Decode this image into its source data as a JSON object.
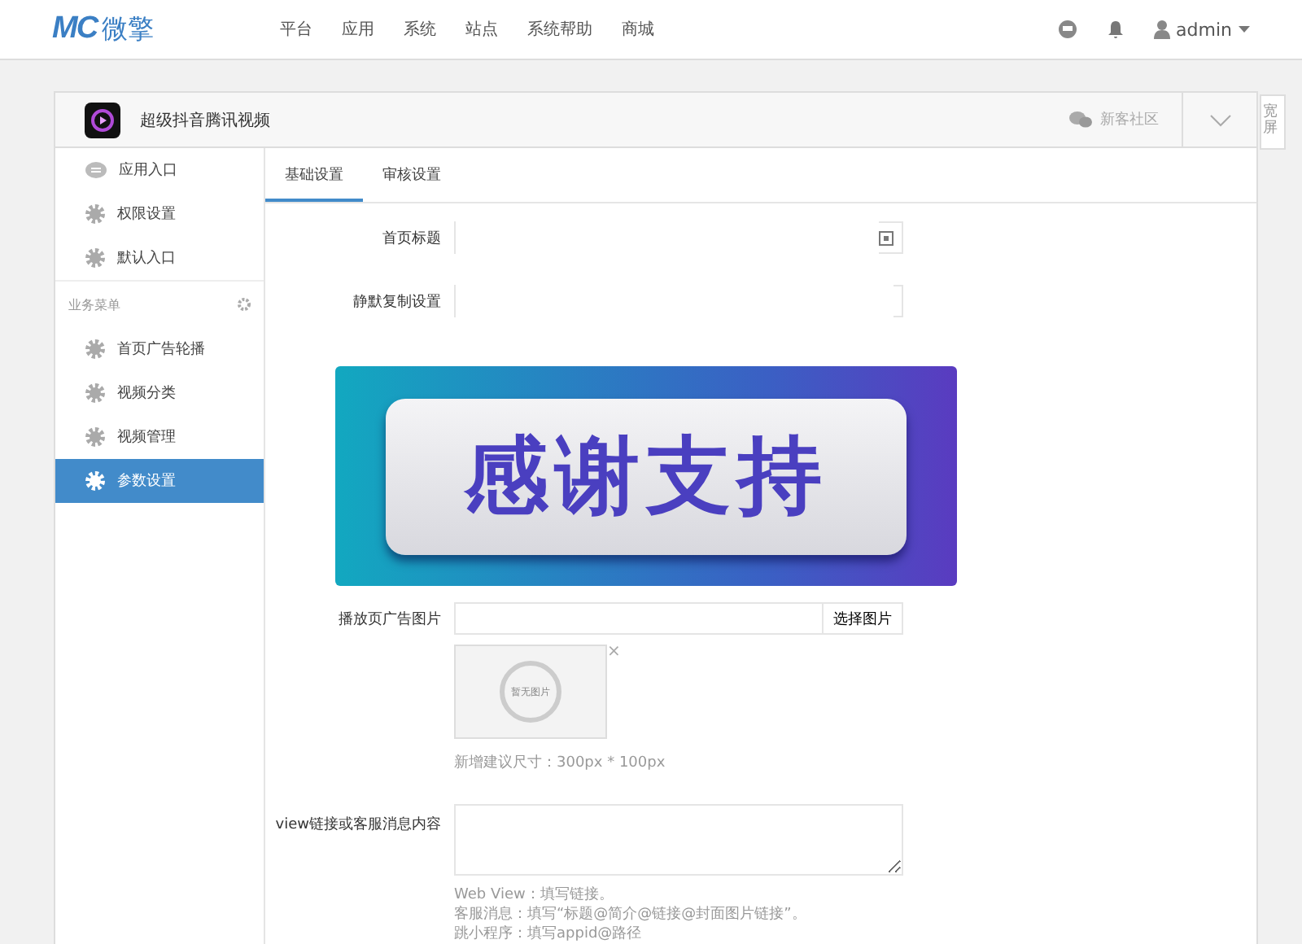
{
  "topbar": {
    "logo_mark": "MC",
    "logo_text": "微擎",
    "nav": [
      "平台",
      "应用",
      "系统",
      "站点",
      "系统帮助",
      "商城"
    ],
    "user": "admin"
  },
  "app": {
    "title": "超级抖音腾讯视频",
    "community": "新客社区"
  },
  "widescreen": "宽屏",
  "sidebar": {
    "items": [
      {
        "label": "应用入口",
        "kind": "chat",
        "selected": false
      },
      {
        "label": "权限设置",
        "kind": "gear",
        "selected": false
      },
      {
        "label": "默认入口",
        "kind": "gear",
        "selected": false
      }
    ],
    "section": "业务菜单",
    "section_items": [
      {
        "label": "首页广告轮播",
        "kind": "gear",
        "selected": false
      },
      {
        "label": "视频分类",
        "kind": "gear",
        "selected": false
      },
      {
        "label": "视频管理",
        "kind": "gear",
        "selected": false
      },
      {
        "label": "参数设置",
        "kind": "gear",
        "selected": true
      }
    ]
  },
  "tabs": [
    {
      "label": "基础设置",
      "selected": true
    },
    {
      "label": "审核设置",
      "selected": false
    }
  ],
  "form": {
    "title_label": "首页标题",
    "copy_label": "静默复制设置",
    "ad_label": "播放页广告图片",
    "ad_button": "选择图片",
    "remove": "×",
    "no_image": "暂无图片",
    "ad_hint": "新增建议尺寸：300px * 100px",
    "view_label": "view链接或客服消息内容",
    "view_hints": [
      "Web View：填写链接。",
      "客服消息：填写“标题@简介@链接@封面图片链接”。",
      "跳小程序：填写appid@路径"
    ]
  },
  "banner": "感谢支持"
}
